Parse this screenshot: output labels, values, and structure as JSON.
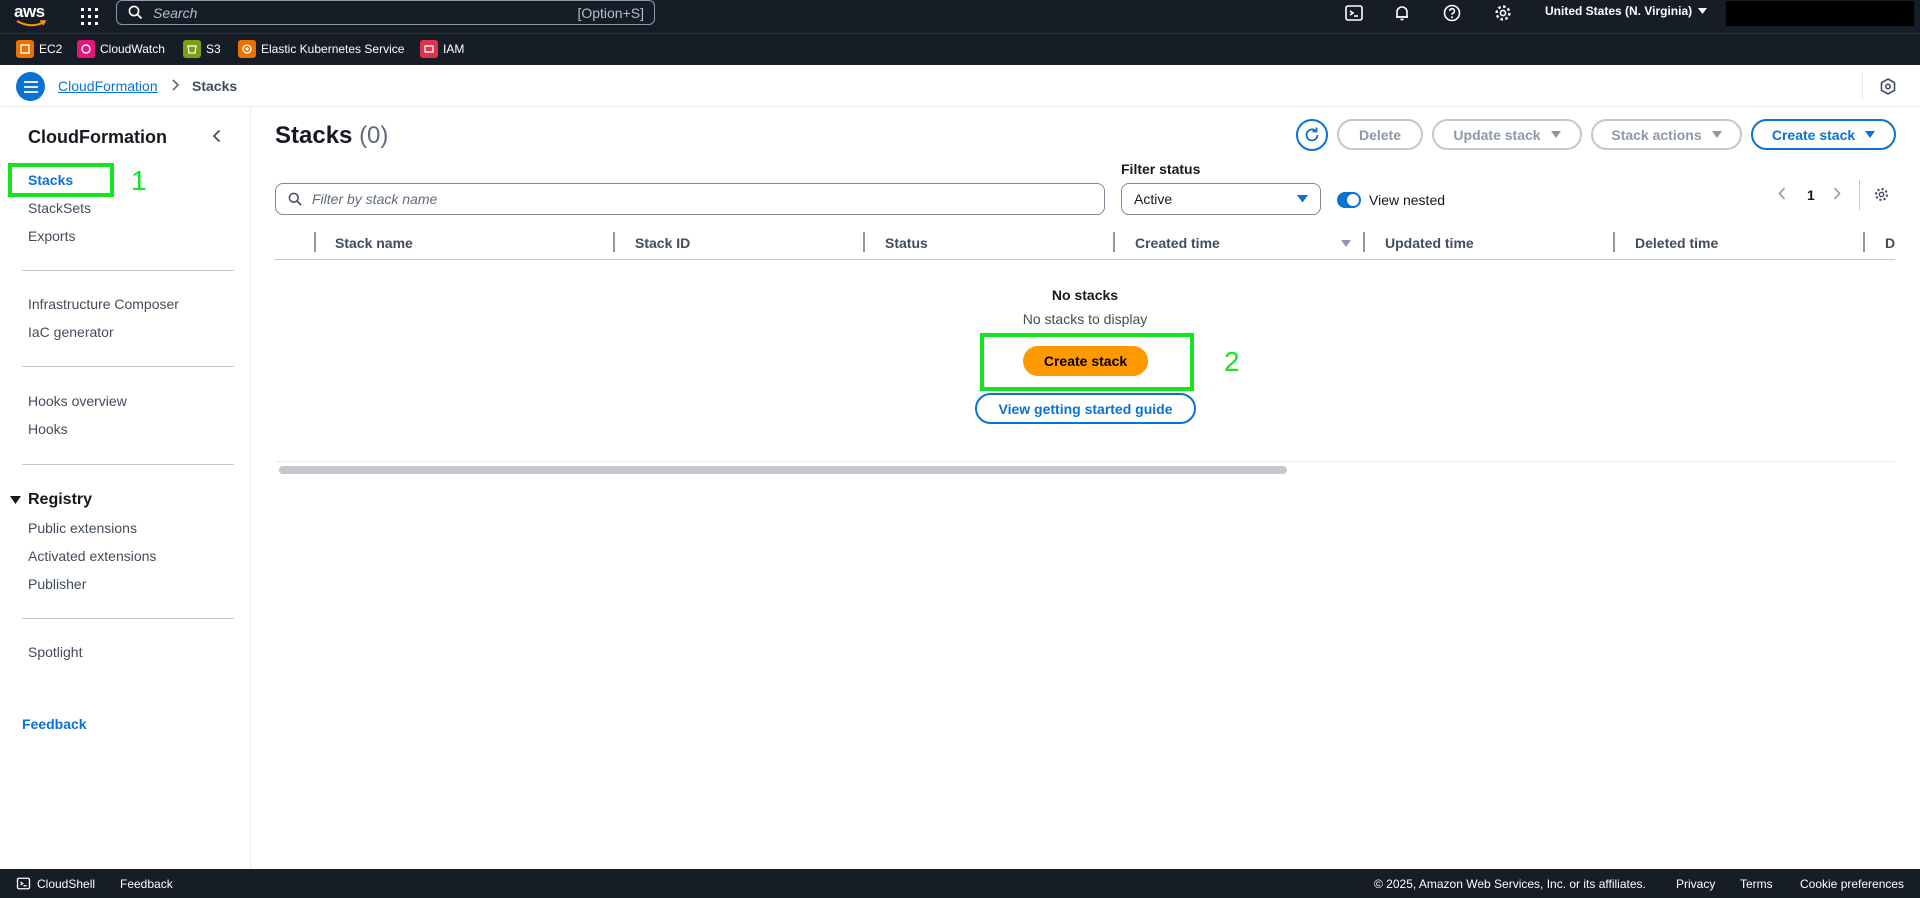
{
  "topnav": {
    "logo": "aws",
    "search_placeholder": "Search",
    "search_shortcut": "[Option+S]",
    "region": "United States (N. Virginia)",
    "icons": [
      "grid-icon",
      "search-icon",
      "cloudshell-icon",
      "bell-icon",
      "help-icon",
      "settings-icon"
    ]
  },
  "servicebar": {
    "items": [
      {
        "label": "EC2",
        "color": "#ed7100"
      },
      {
        "label": "CloudWatch",
        "color": "#e7157b"
      },
      {
        "label": "S3",
        "color": "#7aa116"
      },
      {
        "label": "Elastic Kubernetes Service",
        "color": "#ed7100"
      },
      {
        "label": "IAM",
        "color": "#dd344c"
      }
    ]
  },
  "breadcrumb": {
    "root": "CloudFormation",
    "current": "Stacks"
  },
  "sidebar": {
    "title": "CloudFormation",
    "group1": [
      "Stacks",
      "StackSets",
      "Exports"
    ],
    "group2": [
      "Infrastructure Composer",
      "IaC generator"
    ],
    "group3": [
      "Hooks overview",
      "Hooks"
    ],
    "registry_title": "Registry",
    "registry_items": [
      "Public extensions",
      "Activated extensions",
      "Publisher"
    ],
    "group5": [
      "Spotlight"
    ],
    "feedback": "Feedback"
  },
  "main": {
    "title": "Stacks",
    "count": "(0)",
    "buttons": {
      "delete": "Delete",
      "update": "Update stack",
      "actions": "Stack actions",
      "create": "Create stack"
    },
    "filter_placeholder": "Filter by stack name",
    "filter_status_label": "Filter status",
    "filter_status_value": "Active",
    "view_nested": "View nested",
    "page": "1",
    "columns": [
      "Stack name",
      "Stack ID",
      "Status",
      "Created time",
      "Updated time",
      "Deleted time",
      "D"
    ],
    "empty_title": "No stacks",
    "empty_subtitle": "No stacks to display",
    "empty_create": "Create stack",
    "empty_guide": "View getting started guide"
  },
  "annotations": [
    "1",
    "2"
  ],
  "footer": {
    "cloudshell": "CloudShell",
    "feedback": "Feedback",
    "copyright": "© 2025, Amazon Web Services, Inc. or its affiliates.",
    "privacy": "Privacy",
    "terms": "Terms",
    "cookies": "Cookie preferences"
  },
  "colors": {
    "accent": "#0972d3",
    "cta": "#ff9900",
    "nav_bg": "#161d26",
    "annotation": "#13e61d"
  }
}
